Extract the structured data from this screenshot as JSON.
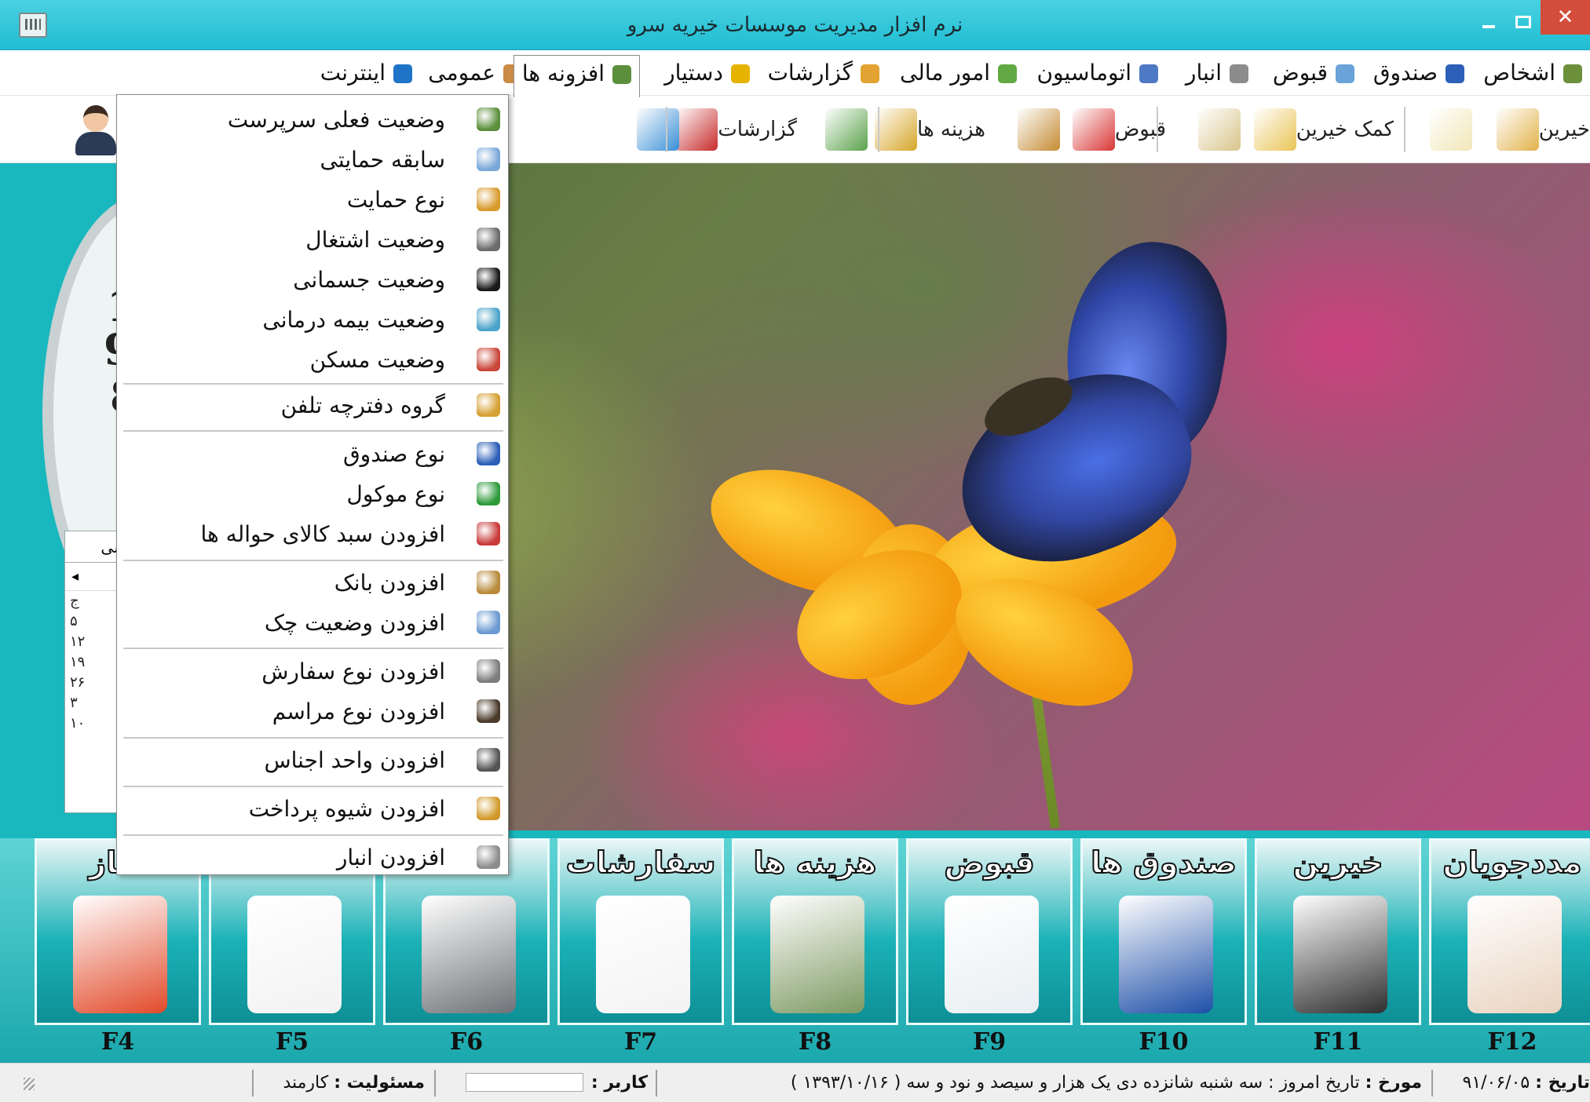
{
  "window": {
    "title": "نرم افزار مدیریت موسسات خیریه سرو",
    "minimize_glyph": "",
    "close_glyph": "✕"
  },
  "menubar": {
    "items": [
      {
        "label": "اشخاص",
        "icon": "persons-icon",
        "color": "#6b8f3b"
      },
      {
        "label": "صندوق",
        "icon": "charity-box-icon",
        "color": "#2c5fb8"
      },
      {
        "label": "قبوض",
        "icon": "receipt-icon",
        "color": "#6aa3d8"
      },
      {
        "label": "انبار",
        "icon": "warehouse-icon",
        "color": "#8c8c8c"
      },
      {
        "label": "اتوماسیون",
        "icon": "automation-icon",
        "color": "#4e79c4"
      },
      {
        "label": "امور مالی",
        "icon": "money-icon",
        "color": "#62a943"
      },
      {
        "label": "گزارشات",
        "icon": "reports-icon",
        "color": "#e2a332"
      },
      {
        "label": "دستیار",
        "icon": "wand-icon",
        "color": "#e6b400"
      },
      {
        "label": "افزونه ها",
        "icon": "addons-icon",
        "color": "#5c8f3c"
      },
      {
        "label": "عمومی",
        "icon": "wrench-icon",
        "color": "#c98b45"
      },
      {
        "label": "اینترنت",
        "icon": "ie-icon",
        "color": "#1f74c8"
      }
    ]
  },
  "toolbar": {
    "buttons": [
      {
        "label": "خیرین",
        "icon": "pencil-icon",
        "color": "#e2b24a"
      },
      {
        "label": "",
        "icon": "notepad-icon",
        "color": "#f1e7b7"
      },
      {
        "label": "کمک خیرین",
        "icon": "coins-hand-icon",
        "color": "#e9c455"
      },
      {
        "label": "",
        "icon": "clipboard-icon",
        "color": "#d8c48a"
      },
      {
        "label": "قبوض",
        "icon": "folder-red-icon",
        "color": "#d93535"
      },
      {
        "label": "",
        "icon": "stamp-icon",
        "color": "#c58a32"
      },
      {
        "label": "هزینه ها",
        "icon": "money-bag-icon",
        "color": "#d7a62a"
      },
      {
        "label": "",
        "icon": "cash-stack-icon",
        "color": "#5aa14a"
      },
      {
        "label": "گزارشات",
        "icon": "report-book-icon",
        "color": "#c72a2a"
      },
      {
        "label": "",
        "icon": "bar-chart-icon",
        "color": "#3a8fd6"
      }
    ]
  },
  "dropdown": {
    "items": [
      {
        "label": "وضعیت فعلی سرپرست",
        "icon": "guardian-icon",
        "color": "#5b8f3b"
      },
      {
        "label": "سابقه حمایتی",
        "icon": "calendar-grid-icon",
        "color": "#7aa7d8"
      },
      {
        "label": "نوع حمایت",
        "icon": "hand-coin-icon",
        "color": "#d89b2c"
      },
      {
        "label": "وضعیت اشتغال",
        "icon": "worker-icon",
        "color": "#6b6b6b"
      },
      {
        "label": "وضعیت جسمانی",
        "icon": "wheelchair-icon",
        "color": "#1b1b1b"
      },
      {
        "label": "وضعیت بیمه درمانی",
        "icon": "health-insurance-icon",
        "color": "#4aa3c9"
      },
      {
        "label": "وضعیت مسکن",
        "icon": "house-icon",
        "color": "#c9463a"
      },
      {
        "label": "گروه دفترچه تلفن",
        "icon": "phonebook-group-icon",
        "color": "#d6a032"
      },
      {
        "label": "نوع صندوق",
        "icon": "charity-box-icon",
        "color": "#2c5fb8"
      },
      {
        "label": "نوع موکول",
        "icon": "refresh-icon",
        "color": "#2e9b3b"
      },
      {
        "label": "افزودن سبد کالای حواله ها",
        "icon": "shopping-bag-icon",
        "color": "#c93a3a"
      },
      {
        "label": "افزودن بانک",
        "icon": "bank-icon",
        "color": "#b88a3a"
      },
      {
        "label": "افزودن وضعیت چک",
        "icon": "cheque-icon",
        "color": "#6a9ad1"
      },
      {
        "label": "افزودن نوع سفارش",
        "icon": "order-form-icon",
        "color": "#7d7d7d"
      },
      {
        "label": "افزودن نوع مراسم",
        "icon": "ceremony-icon",
        "color": "#4a3a2a"
      },
      {
        "label": "افزودن واحد اجناس",
        "icon": "unit-list-icon",
        "color": "#555555"
      },
      {
        "label": "افزودن شیوه پرداخت",
        "icon": "payment-method-icon",
        "color": "#d29a2c"
      },
      {
        "label": "افزودن انبار",
        "icon": "warehouse-icon",
        "color": "#8c8c8c"
      }
    ]
  },
  "leftpanel": {
    "clock_digits": [
      "1",
      "9",
      "8"
    ],
    "calendar_header": "لیسی",
    "calendar_nav": "◂",
    "calendar_cells": [
      "ج",
      "۵",
      "۱۲",
      "۱۹",
      "۲۶",
      "۳",
      "۱۰"
    ]
  },
  "tiles": [
    {
      "title": "مددجویان",
      "fkey": "F12",
      "icon": "client-avatar-icon",
      "color": "#e9d3c0"
    },
    {
      "title": "خیرین",
      "fkey": "F11",
      "icon": "benefactor-avatar-icon",
      "color": "#2f2f2f"
    },
    {
      "title": "صندوق ها",
      "fkey": "F10",
      "icon": "charity-box-icon",
      "color": "#1e4fa8"
    },
    {
      "title": "قبوض",
      "fkey": "F9",
      "icon": "scroll-receipt-icon",
      "color": "#e8eef2"
    },
    {
      "title": "هزینه ها",
      "fkey": "F8",
      "icon": "cash-stack-icon",
      "color": "#7e9a63"
    },
    {
      "title": "سفارشات",
      "fkey": "F7",
      "icon": "checklist-icon",
      "color": "#f3f3f3"
    },
    {
      "title": "",
      "fkey": "F6",
      "icon": "safe-icon",
      "color": "#6f7377"
    },
    {
      "title": "",
      "fkey": "F5",
      "icon": "report-edit-icon",
      "color": "#f2f2f2"
    },
    {
      "title": "ساز",
      "fkey": "F4",
      "icon": "chart-builder-icon",
      "color": "#e24a2a"
    }
  ],
  "statusbar": {
    "date_label": "تاریخ :",
    "date_value": "۹۱/۰۶/۰۵",
    "historian_label": "مورخ :",
    "historian_value": "تاریخ امروز : سه شنبه شانزده  دی یک هزار و سیصد و نود و سه ( ۱۳۹۳/۱۰/۱۶ )",
    "user_label": "کاربر :",
    "user_value": "",
    "role_label": "مسئولیت :",
    "role_value": "کارمند"
  }
}
